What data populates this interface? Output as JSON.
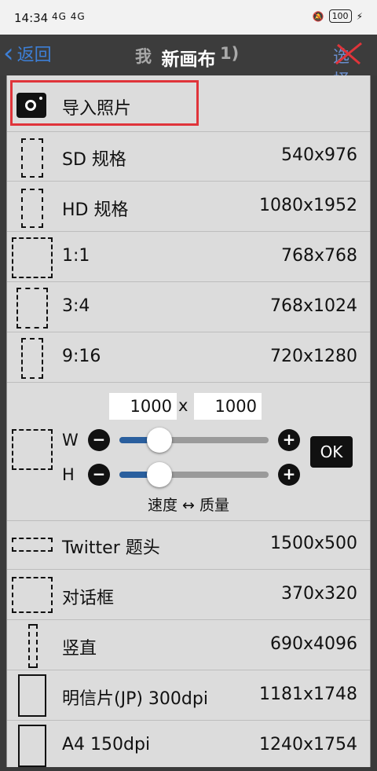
{
  "status": {
    "time": "14:34",
    "signal": "4G 4G",
    "battery": "100"
  },
  "header": {
    "back": "返回",
    "title": "新画布",
    "under_title": "我",
    "under_count": "1)",
    "select": "选择"
  },
  "import": {
    "label": "导入照片"
  },
  "presets": [
    {
      "label": "SD 规格",
      "size": "540x976"
    },
    {
      "label": "HD 规格",
      "size": "1080x1952"
    },
    {
      "label": "1:1",
      "size": "768x768"
    },
    {
      "label": "3:4",
      "size": "768x1024"
    },
    {
      "label": "9:16",
      "size": "720x1280"
    }
  ],
  "custom": {
    "width": "1000",
    "x": "x",
    "height": "1000",
    "w_label": "W",
    "h_label": "H",
    "w_level": 0.27,
    "h_level": 0.27,
    "ok": "OK",
    "tradeoff": "速度 ↔ 质量",
    "minus": "−",
    "plus": "+"
  },
  "presets2": [
    {
      "label": "Twitter 题头",
      "size": "1500x500"
    },
    {
      "label": "对话框",
      "size": "370x320"
    },
    {
      "label": "竖直",
      "size": "690x4096"
    },
    {
      "label": "明信片(JP) 300dpi",
      "size": "1181x1748"
    },
    {
      "label": "A4 150dpi",
      "size": "1240x1754"
    }
  ],
  "colors": {
    "accent": "#2a5f9e",
    "highlight": "#e0343a",
    "back": "#3d7fd6"
  }
}
